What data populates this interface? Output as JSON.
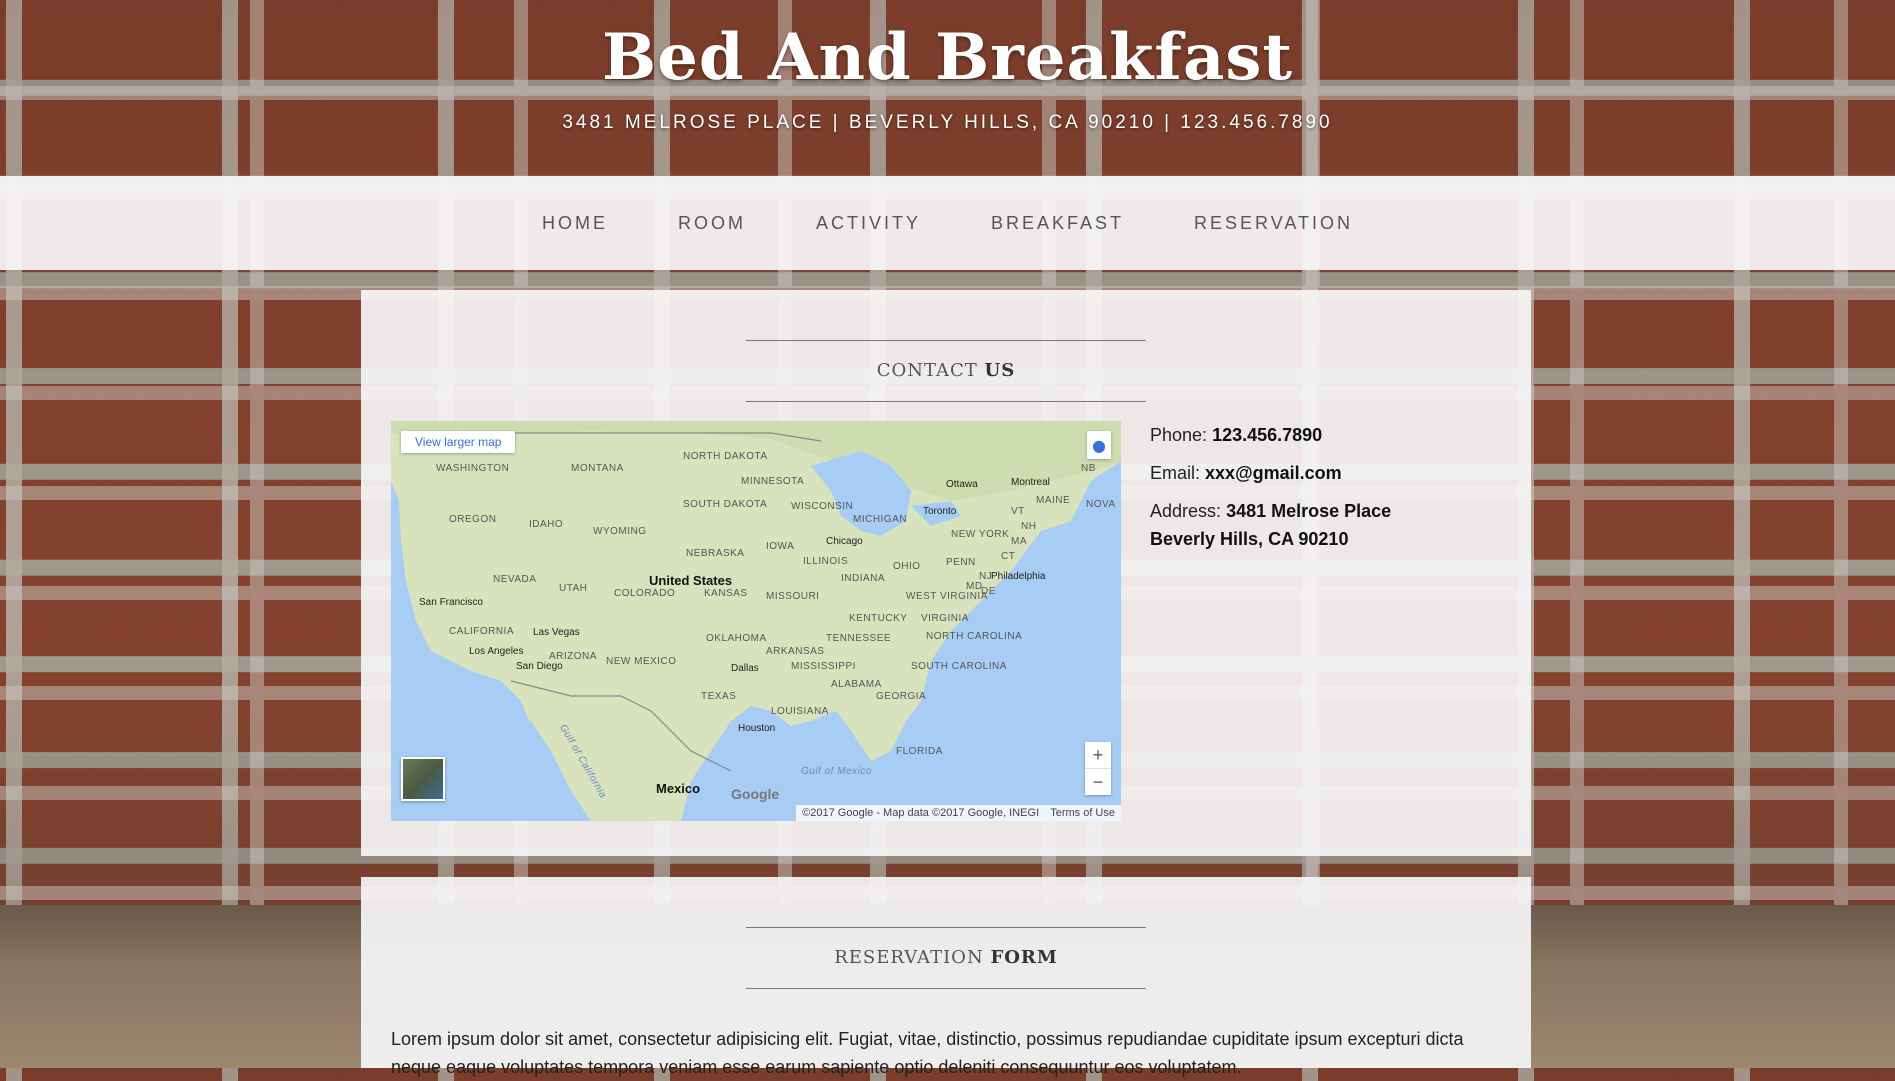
{
  "header": {
    "title": "Bed And Breakfast",
    "address": "3481 MELROSE PLACE | BEVERLY HILLS, CA 90210 | 123.456.7890"
  },
  "nav": {
    "items": [
      {
        "label": "HOME"
      },
      {
        "label": "ROOM"
      },
      {
        "label": "ACTIVITY"
      },
      {
        "label": "BREAKFAST"
      },
      {
        "label": "RESERVATION"
      }
    ]
  },
  "contact": {
    "heading_light": "CONTACT",
    "heading_bold": "US",
    "phone_label": "Phone:",
    "phone_value": "123.456.7890",
    "email_label": "Email:",
    "email_value": "xxx@gmail.com",
    "address_label": "Address:",
    "address_line1": "3481 Melrose Place",
    "address_line2": "Beverly Hills, CA 90210"
  },
  "map": {
    "view_larger": "View larger map",
    "zoom_in": "+",
    "zoom_out": "−",
    "google": "Google",
    "attribution": "©2017 Google - Map data ©2017 Google, INEGI",
    "terms": "Terms of Use",
    "labels": [
      {
        "text": "NORTH DAKOTA",
        "kind": "state"
      },
      {
        "text": "MINNESOTA",
        "kind": "state"
      },
      {
        "text": "WASHINGTON",
        "kind": "state"
      },
      {
        "text": "MONTANA",
        "kind": "state"
      },
      {
        "text": "SOUTH DAKOTA",
        "kind": "state"
      },
      {
        "text": "WISCONSIN",
        "kind": "state"
      },
      {
        "text": "OREGON",
        "kind": "state"
      },
      {
        "text": "IDAHO",
        "kind": "state"
      },
      {
        "text": "WYOMING",
        "kind": "state"
      },
      {
        "text": "MICHIGAN",
        "kind": "state"
      },
      {
        "text": "NEBRASKA",
        "kind": "state"
      },
      {
        "text": "IOWA",
        "kind": "state"
      },
      {
        "text": "NEVADA",
        "kind": "state"
      },
      {
        "text": "UTAH",
        "kind": "state"
      },
      {
        "text": "COLORADO",
        "kind": "state"
      },
      {
        "text": "KANSAS",
        "kind": "state"
      },
      {
        "text": "MISSOURI",
        "kind": "state"
      },
      {
        "text": "ILLINOIS",
        "kind": "state"
      },
      {
        "text": "INDIANA",
        "kind": "state"
      },
      {
        "text": "OHIO",
        "kind": "state"
      },
      {
        "text": "PENN",
        "kind": "state"
      },
      {
        "text": "CALIFORNIA",
        "kind": "state"
      },
      {
        "text": "ARIZONA",
        "kind": "state"
      },
      {
        "text": "NEW MEXICO",
        "kind": "state"
      },
      {
        "text": "OKLAHOMA",
        "kind": "state"
      },
      {
        "text": "ARKANSAS",
        "kind": "state"
      },
      {
        "text": "TENNESSEE",
        "kind": "state"
      },
      {
        "text": "KENTUCKY",
        "kind": "state"
      },
      {
        "text": "WEST VIRGINIA",
        "kind": "state"
      },
      {
        "text": "VIRGINIA",
        "kind": "state"
      },
      {
        "text": "NORTH CAROLINA",
        "kind": "state"
      },
      {
        "text": "SOUTH CAROLINA",
        "kind": "state"
      },
      {
        "text": "MISSISSIPPI",
        "kind": "state"
      },
      {
        "text": "ALABAMA",
        "kind": "state"
      },
      {
        "text": "GEORGIA",
        "kind": "state"
      },
      {
        "text": "TEXAS",
        "kind": "state"
      },
      {
        "text": "LOUISIANA",
        "kind": "state"
      },
      {
        "text": "FLORIDA",
        "kind": "state"
      },
      {
        "text": "NEW YORK",
        "kind": "state"
      },
      {
        "text": "MAINE",
        "kind": "state"
      },
      {
        "text": "VT",
        "kind": "state"
      },
      {
        "text": "NH",
        "kind": "state"
      },
      {
        "text": "MA",
        "kind": "state"
      },
      {
        "text": "CT",
        "kind": "state"
      },
      {
        "text": "MD",
        "kind": "state"
      },
      {
        "text": "DE",
        "kind": "state"
      },
      {
        "text": "NJ",
        "kind": "state"
      },
      {
        "text": "NB",
        "kind": "state"
      },
      {
        "text": "NOVA",
        "kind": "state"
      },
      {
        "text": "Ottawa",
        "kind": "city"
      },
      {
        "text": "Montreal",
        "kind": "city"
      },
      {
        "text": "Toronto",
        "kind": "city"
      },
      {
        "text": "Chicago",
        "kind": "city"
      },
      {
        "text": "Philadelphia",
        "kind": "city"
      },
      {
        "text": "San Francisco",
        "kind": "city"
      },
      {
        "text": "Las Vegas",
        "kind": "city"
      },
      {
        "text": "Los Angeles",
        "kind": "city"
      },
      {
        "text": "San Diego",
        "kind": "city"
      },
      {
        "text": "Dallas",
        "kind": "city"
      },
      {
        "text": "Houston",
        "kind": "city"
      },
      {
        "text": "United States",
        "kind": "country"
      },
      {
        "text": "Mexico",
        "kind": "country"
      },
      {
        "text": "Gulf of California",
        "kind": "water"
      },
      {
        "text": "Gulf of Mexico",
        "kind": "water"
      }
    ]
  },
  "reservation": {
    "heading_light": "RESERVATION",
    "heading_bold": "FORM",
    "intro": "Lorem ipsum dolor sit amet, consectetur adipisicing elit. Fugiat, vitae, distinctio, possimus repudiandae cupiditate ipsum excepturi dicta neque eaque voluptates tempora veniam esse earum sapiente optio deleniti consequuntur eos voluptatem."
  }
}
